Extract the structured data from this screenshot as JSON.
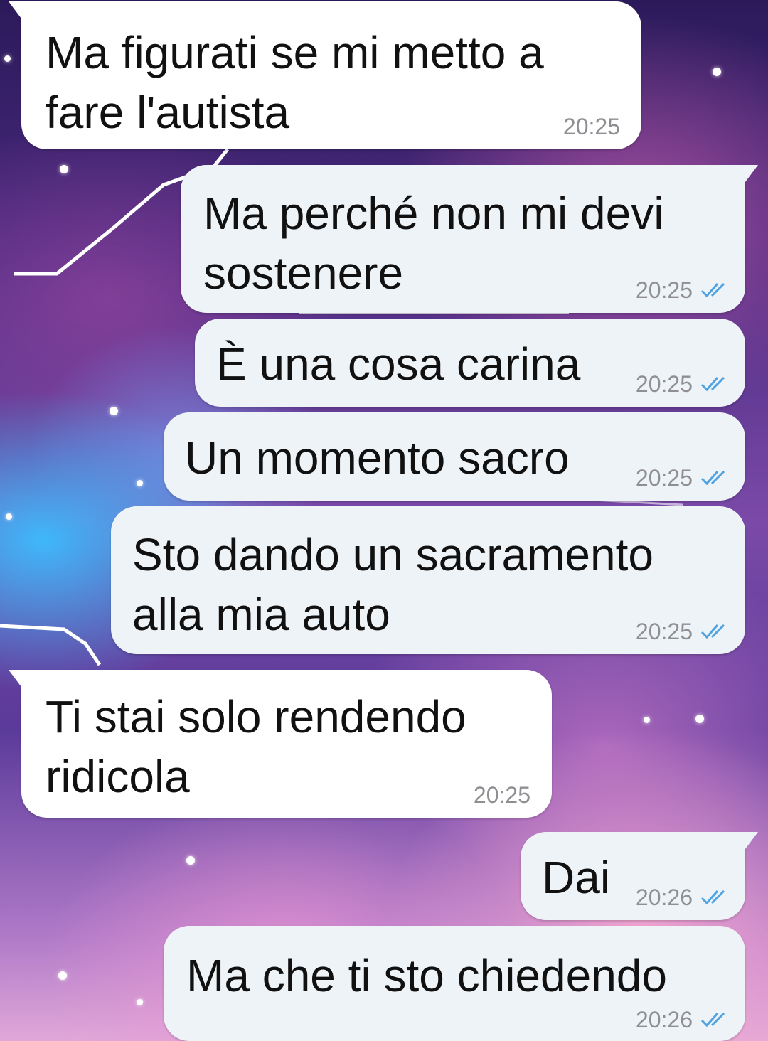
{
  "chat": {
    "messages": [
      {
        "direction": "in",
        "text": "Ma figurati se mi metto a\nfare l'autista",
        "time": "20:25"
      },
      {
        "direction": "out",
        "text": "Ma perché non mi devi\nsostenere",
        "time": "20:25",
        "status": "read"
      },
      {
        "direction": "out",
        "text": "È una cosa carina",
        "time": "20:25",
        "status": "read"
      },
      {
        "direction": "out",
        "text": "Un momento sacro",
        "time": "20:25",
        "status": "read"
      },
      {
        "direction": "out",
        "text": "Sto dando un sacramento\nalla mia auto",
        "time": "20:25",
        "status": "read"
      },
      {
        "direction": "in",
        "text": "Ti stai solo rendendo\nridicola",
        "time": "20:25"
      },
      {
        "direction": "out",
        "text": "Dai",
        "time": "20:26",
        "status": "read"
      },
      {
        "direction": "out",
        "text": "Ma che ti sto chiedendo",
        "time": "20:26",
        "status": "read"
      }
    ],
    "read_tick_color": "#4fa3e0",
    "incoming_bubble_color": "#ffffff",
    "outgoing_bubble_color": "#eef3f8",
    "wallpaper": "galaxy-night-sky"
  }
}
